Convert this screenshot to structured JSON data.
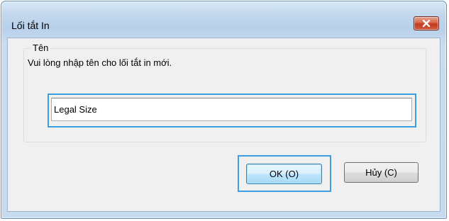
{
  "dialog": {
    "title": "Lối tắt In",
    "close_icon": "close-x-icon",
    "close_color": "#c7422a",
    "group_title": "Tên",
    "instruction": "Vui lòng nhập tên cho lối tắt in mới.",
    "name_value": "Legal Size",
    "ok_label": "OK (O)",
    "cancel_label": "Hủy (C)",
    "focus_color": "#3c9ee0"
  }
}
